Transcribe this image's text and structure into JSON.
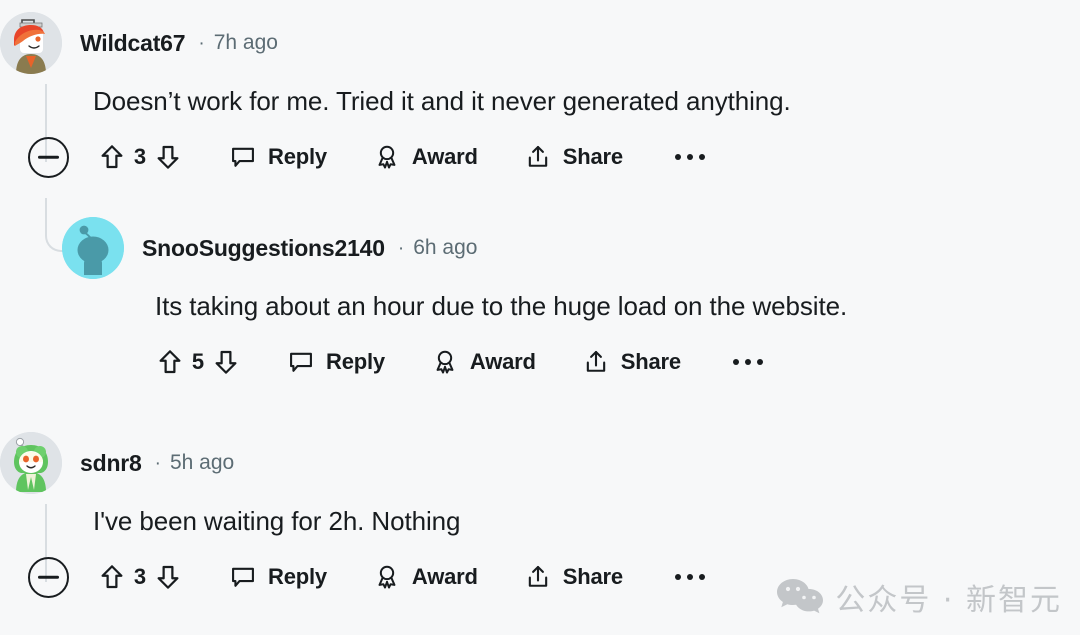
{
  "page": {
    "background": "#f7f8f9",
    "text_color": "#181c1f",
    "muted_color": "#5c6c74",
    "threadline_color": "#d8dde1"
  },
  "comments": [
    {
      "username": "Wildcat67",
      "separator": "·",
      "timestamp": "7h ago",
      "body": "Doesn’t work for me. Tried it and it never generated anything.",
      "score": "3",
      "avatar": "snoo-orange-hair-avatar",
      "has_collapse": true,
      "actions": {
        "reply": "Reply",
        "award": "Award",
        "share": "Share"
      }
    },
    {
      "username": "SnooSuggestions2140",
      "separator": "·",
      "timestamp": "6h ago",
      "body": "Its taking about an hour due to the huge load on the website.",
      "score": "5",
      "avatar": "snoo-cyan-avatar",
      "has_collapse": false,
      "actions": {
        "reply": "Reply",
        "award": "Award",
        "share": "Share"
      }
    },
    {
      "username": "sdnr8",
      "separator": "·",
      "timestamp": "5h ago",
      "body": "I've been waiting for 2h. Nothing",
      "score": "3",
      "avatar": "snoo-green-frog-avatar",
      "has_collapse": true,
      "actions": {
        "reply": "Reply",
        "award": "Award",
        "share": "Share"
      }
    }
  ],
  "watermark": {
    "text": "公众号 · 新智元",
    "icon": "wechat-icon",
    "color": "#c3c6c9"
  }
}
